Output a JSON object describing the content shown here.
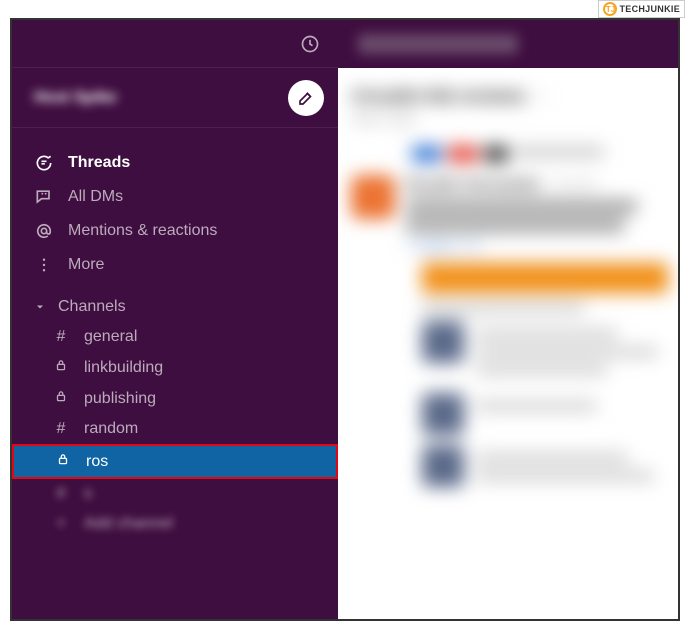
{
  "watermark": {
    "logo": "TJ",
    "text": "TECHJUNKIE"
  },
  "workspace": {
    "name_blurred": "Host Spike"
  },
  "nav": {
    "threads": "Threads",
    "all_dms": "All DMs",
    "mentions": "Mentions & reactions",
    "more": "More"
  },
  "sections": {
    "channels": {
      "label": "Channels",
      "items": [
        {
          "icon": "#",
          "label": "general",
          "selected": false
        },
        {
          "icon": "lock",
          "label": "linkbuilding",
          "selected": false
        },
        {
          "icon": "lock",
          "label": "publishing",
          "selected": false
        },
        {
          "icon": "#",
          "label": "random",
          "selected": false
        },
        {
          "icon": "lock",
          "label": "ros",
          "selected": true,
          "highlighted": true
        },
        {
          "icon": "#",
          "label": "s",
          "blurred": true
        },
        {
          "icon": "+",
          "label": "Add channel",
          "blurred": true
        }
      ]
    }
  },
  "main_blur": {
    "search": "Search Host Spike",
    "channel_title": "#rosalin-feb-reviews",
    "sub": "Add a topic",
    "username": "Rosalin Hernandez",
    "timestamp": "3:00 AM",
    "line1": "Using google search I found this",
    "line2": "discussing about it and we need",
    "replies": "7 replies 1 hr",
    "orange_text": "Kept it in the view I wanted to keep"
  }
}
